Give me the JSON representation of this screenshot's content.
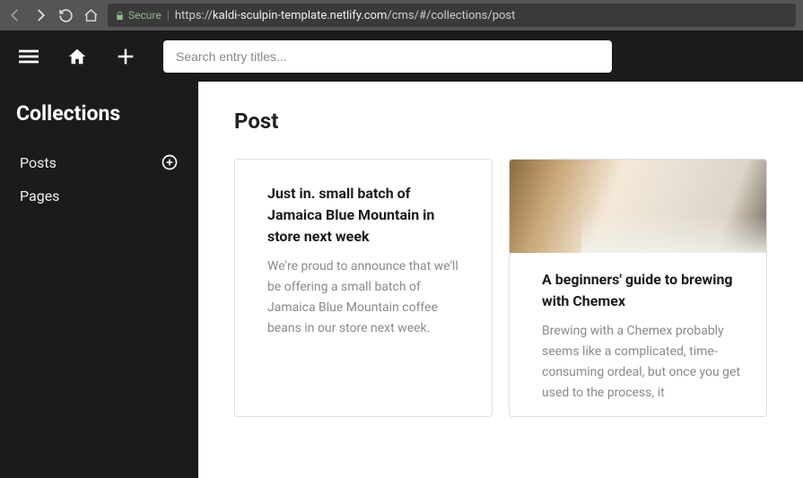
{
  "browser": {
    "secure_label": "Secure",
    "url_display": "https://kaldi-sculpin-template.netlify.com/cms/#/collections/post",
    "url_host": "kaldi-sculpin-template.netlify.com",
    "url_path": "/cms/#/collections/post"
  },
  "toolbar": {
    "search_placeholder": "Search entry titles..."
  },
  "sidebar": {
    "title": "Collections",
    "items": [
      {
        "label": "Posts",
        "has_add": true
      },
      {
        "label": "Pages",
        "has_add": false
      }
    ]
  },
  "main": {
    "heading": "Post",
    "cards": [
      {
        "has_image": false,
        "title": "Just in. small batch of Jamaica Blue Mountain in store next week",
        "desc": "We're proud to announce that we'll be offering a small batch of Jamaica Blue Mountain coffee beans in our store next week."
      },
      {
        "has_image": true,
        "title": "A beginners' guide to brewing with Chemex",
        "desc": "Brewing with a Chemex probably seems like a complicated, time-consuming ordeal, but once you get used to the process, it"
      }
    ]
  }
}
